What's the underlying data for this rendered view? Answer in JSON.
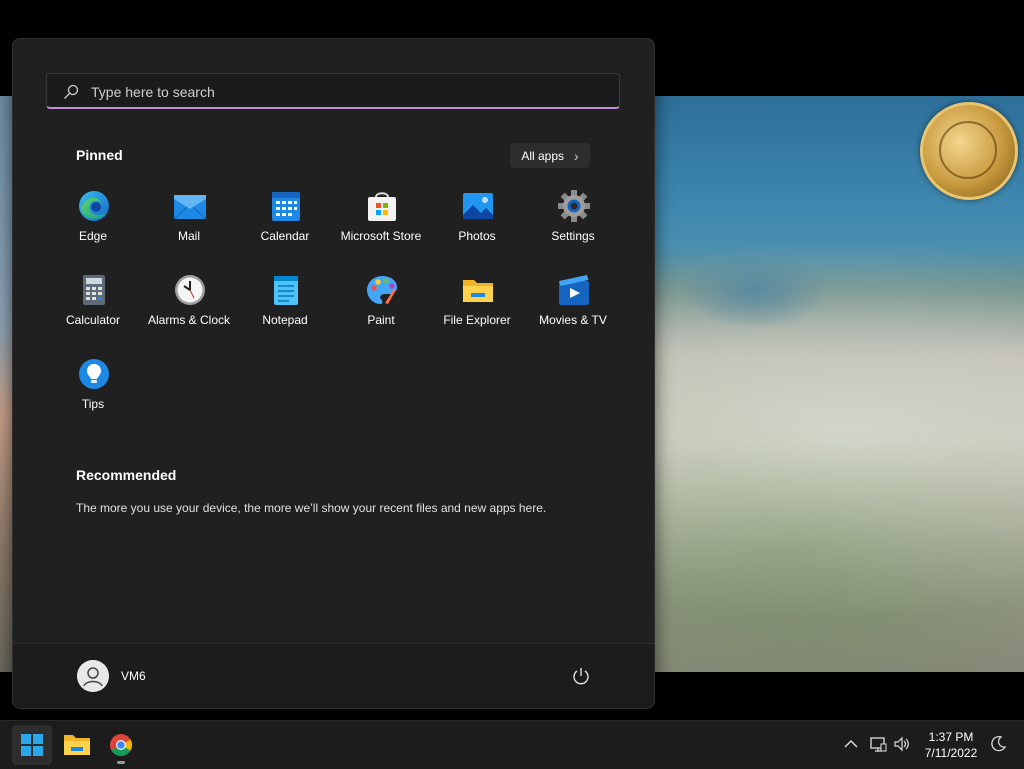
{
  "search": {
    "placeholder": "Type here to search"
  },
  "pinned": {
    "title": "Pinned",
    "all_apps_label": "All apps",
    "apps": [
      {
        "label": "Edge",
        "icon": "edge-icon"
      },
      {
        "label": "Mail",
        "icon": "mail-icon"
      },
      {
        "label": "Calendar",
        "icon": "calendar-icon"
      },
      {
        "label": "Microsoft Store",
        "icon": "microsoft-store-icon"
      },
      {
        "label": "Photos",
        "icon": "photos-icon"
      },
      {
        "label": "Settings",
        "icon": "settings-gear-icon"
      },
      {
        "label": "Calculator",
        "icon": "calculator-icon"
      },
      {
        "label": "Alarms & Clock",
        "icon": "alarm-clock-icon"
      },
      {
        "label": "Notepad",
        "icon": "notepad-icon"
      },
      {
        "label": "Paint",
        "icon": "paint-palette-icon"
      },
      {
        "label": "File Explorer",
        "icon": "folder-icon"
      },
      {
        "label": "Movies & TV",
        "icon": "movies-tv-icon"
      },
      {
        "label": "Tips",
        "icon": "lightbulb-icon"
      }
    ]
  },
  "recommended": {
    "title": "Recommended",
    "text": "The more you use your device, the more we’ll show your recent files and new apps here."
  },
  "user": {
    "name": "VM6"
  },
  "taskbar": {
    "items": [
      "start-icon",
      "file-explorer-icon",
      "chrome-icon"
    ],
    "tray_icons": [
      "chevron-up-icon",
      "network-icon",
      "volume-icon",
      "moon-icon"
    ]
  },
  "clock": {
    "time": "1:37 PM",
    "date": "7/11/2022"
  },
  "colors": {
    "accent": "#c08bd1",
    "menu_bg": "#202020",
    "taskbar_bg": "#1c1c1c"
  }
}
